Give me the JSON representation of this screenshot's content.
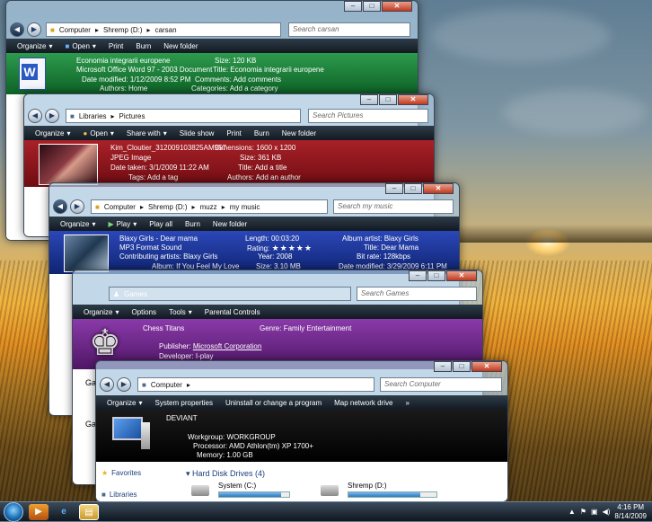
{
  "w1": {
    "crumbs": [
      "Computer",
      "Shremp (D:)",
      "carsan"
    ],
    "search": "Search carsan",
    "toolbar": [
      "Organize",
      "Open",
      "Print",
      "Burn",
      "New folder"
    ],
    "name": "Economia integrarii europene",
    "type": "Microsoft Office Word 97 - 2003 Document",
    "date_label": "Date modified:",
    "date": "1/12/2009 8:52 PM",
    "authors_label": "Authors:",
    "authors": "Home",
    "size_label": "Size:",
    "size": "120 KB",
    "title_label": "Title:",
    "title": "Economia integrarii europene",
    "comments_label": "Comments:",
    "comments": "Add comments",
    "cat_label": "Categories:",
    "cat": "Add a category"
  },
  "w2": {
    "crumbs": [
      "Libraries",
      "Pictures"
    ],
    "search": "Search Pictures",
    "toolbar": [
      "Organize",
      "Open",
      "Share with",
      "Slide show",
      "Print",
      "Burn",
      "New folder"
    ],
    "name": "Kim_Cloutier_312009103825AM957",
    "type": "JPEG Image",
    "taken_label": "Date taken:",
    "taken": "3/1/2009 11:22 AM",
    "tags_label": "Tags:",
    "tags": "Add a tag",
    "dim_label": "Dimensions:",
    "dim": "1600 x 1200",
    "size_label": "Size:",
    "size": "361 KB",
    "title_label": "Title:",
    "title": "Add a title",
    "authors_label": "Authors:",
    "authors": "Add an author"
  },
  "w3": {
    "crumbs": [
      "Computer",
      "Shremp (D:)",
      "muzz",
      "my music"
    ],
    "search": "Search my music",
    "toolbar": [
      "Organize",
      "Play",
      "Play all",
      "Burn",
      "New folder"
    ],
    "name": "Blaxy Girls - Dear mama",
    "type": "MP3 Format Sound",
    "contrib_label": "Contributing artists:",
    "contrib": "Blaxy Girls",
    "album_label": "Album:",
    "album": "If You Feel My Love",
    "length_label": "Length:",
    "length": "00:03:20",
    "rating_label": "Rating:",
    "rating": "★★★★★",
    "year_label": "Year:",
    "year": "2008",
    "size_label": "Size:",
    "size": "3.10 MB",
    "aa_label": "Album artist:",
    "aa": "Blaxy Girls",
    "title_label": "Title:",
    "title": "Dear Mama",
    "br_label": "Bit rate:",
    "br": "128kbps",
    "dm_label": "Date modified:",
    "dm": "3/29/2009 6:11 PM"
  },
  "w4": {
    "crumbs": [
      "Games"
    ],
    "search": "Search Games",
    "toolbar": [
      "Organize",
      "Options",
      "Tools",
      "Parental Controls"
    ],
    "name": "Chess Titans",
    "genre_label": "Genre:",
    "genre": "Family Entertainment",
    "pub_label": "Publisher:",
    "pub": "Microsoft Corporation",
    "dev_label": "Developer:",
    "dev": "I-play",
    "side": [
      "Ga",
      "Ga"
    ]
  },
  "w5": {
    "crumbs": [
      "Computer"
    ],
    "search": "Search Computer",
    "toolbar": [
      "Organize",
      "System properties",
      "Uninstall or change a program",
      "Map network drive"
    ],
    "more": "»",
    "name": "DEVIANT",
    "wg_label": "Workgroup:",
    "wg": "WORKGROUP",
    "proc_label": "Processor:",
    "proc": "AMD Athlon(tm) XP 1700+",
    "mem_label": "Memory:",
    "mem": "1.00 GB",
    "fav": "Favorites",
    "libs": "Libraries",
    "group": "Hard Disk Drives (4)",
    "drives": [
      {
        "name": "System (C:)",
        "fill": 0.88
      },
      {
        "name": "Shremp (D:)",
        "fill": 0.82
      }
    ]
  },
  "taskbar": {
    "time": "4:16 PM",
    "date": "8/14/2009"
  },
  "captions": {
    "min": "–",
    "max": "□",
    "close": "✕"
  }
}
